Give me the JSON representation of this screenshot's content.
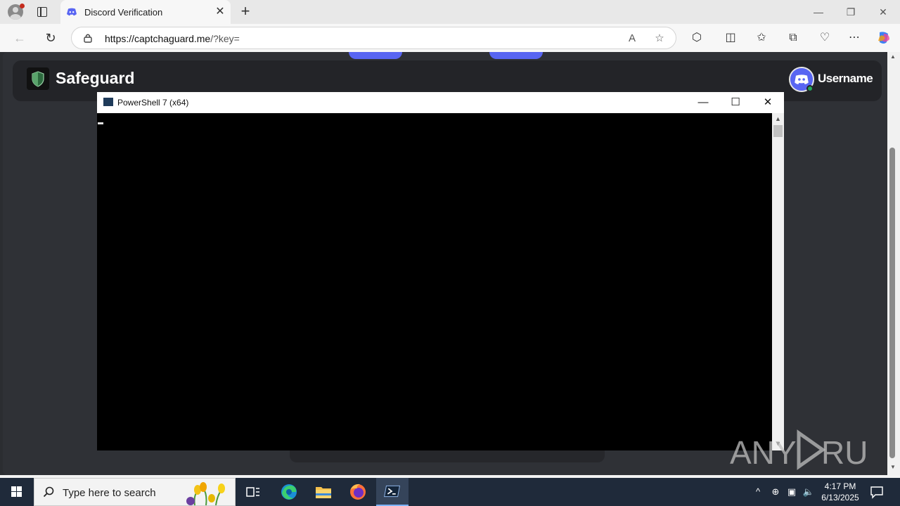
{
  "browser": {
    "tab_title": "Discord Verification",
    "tab_close": "✕",
    "new_tab": "+",
    "url_host": "https://captchaguard.me",
    "url_path": "/?key="
  },
  "page": {
    "brand_name": "Safeguard",
    "username": "Username"
  },
  "powershell": {
    "window_title": "PowerShell 7 (x64)",
    "minimize": "—",
    "maximize": "☐",
    "close": "✕"
  },
  "watermark": {
    "text_left": "ANY",
    "text_right": "RUN"
  },
  "taskbar": {
    "search_placeholder": "Type here to search",
    "time": "4:17 PM",
    "date": "6/13/2025"
  },
  "colors": {
    "discord_blurple": "#5865f2",
    "online_green": "#23a55a",
    "taskbar_bg": "#1f2a3a"
  }
}
